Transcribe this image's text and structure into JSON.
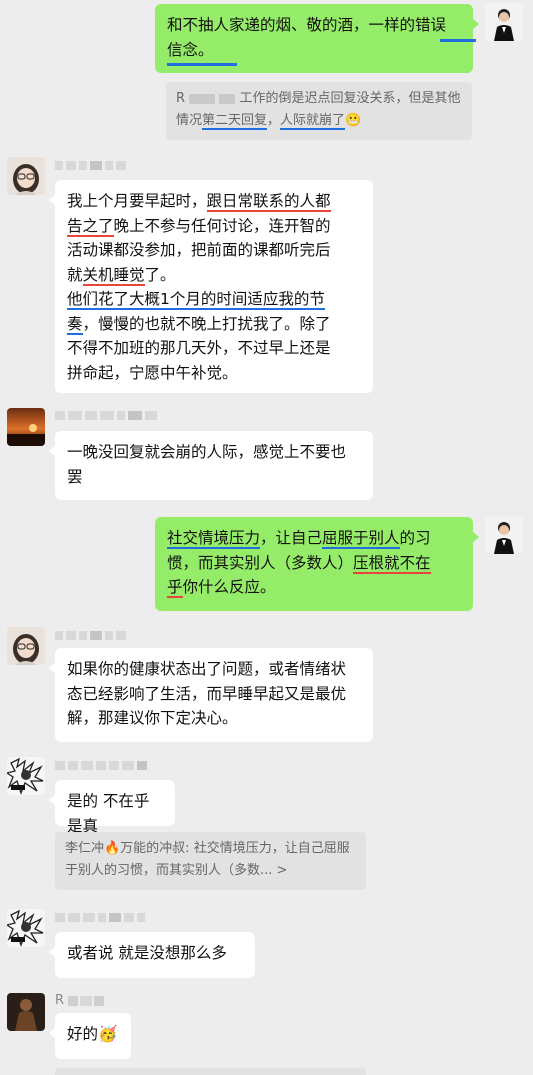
{
  "messages": {
    "m1": {
      "text": "和不抽人家递的烟、敬的酒，一样的错误信念。"
    },
    "q1": {
      "prefix": "R",
      "text_a": "工作的倒是迟点回复没关系，但是其他情况",
      "text_b": "第二天回复",
      "text_c": "，",
      "text_d": "人际就崩了",
      "emoji": "😬"
    },
    "m2": {
      "l1a": "我上个月要早起时，",
      "l1b": "跟日常联系的人都",
      "l2a": "告之了",
      "l2b": "晚上不参与任何讨论，连开智的",
      "l3": "活动课都没参加，把前面的课都听完后",
      "l4a": "就",
      "l4b": "关机睡觉",
      "l4c": "了。",
      "l5a": "他们花了大概1个月的时间",
      "l5b": "适应我的节",
      "l6a": "奏",
      "l6b": "，慢慢的也就不晚上打扰我了。除了",
      "l7": "不得不加班的那几天外，不过早上还是",
      "l8": "拼命起，宁愿中午补觉。"
    },
    "m3": {
      "text": "一晚没回复就会崩的人际，感觉上不要也罢"
    },
    "m4": {
      "l1a": "社交情境压力",
      "l1b": "，让自己",
      "l1c": "屈服于别人",
      "l1d": "的习",
      "l2a": "惯，而其实别人（多数人）",
      "l2b": "压根就不在",
      "l3a": "乎",
      "l3b": "你什么反应。"
    },
    "m5": {
      "text": "如果你的健康状态出了问题，或者情绪状态已经影响了生活，而早睡早起又是最优解，那建议你下定决心。"
    },
    "m6": {
      "text": "是的 不在乎是真"
    },
    "q2": {
      "text": "李仁冲🔥万能的冲叔: 社交情境压力，让自己屈服于别人的习惯，而其实别人（多数... >"
    },
    "m7": {
      "text": "或者说 就是没想那么多"
    },
    "m8": {
      "text": "好的",
      "emoji": "🥳"
    },
    "name8": {
      "prefix": "R"
    }
  },
  "colors": {
    "green": "#95ec69",
    "white": "#ffffff",
    "bg": "#ededed",
    "red_underline": "#e8463d",
    "blue_underline": "#1f6fe0"
  }
}
